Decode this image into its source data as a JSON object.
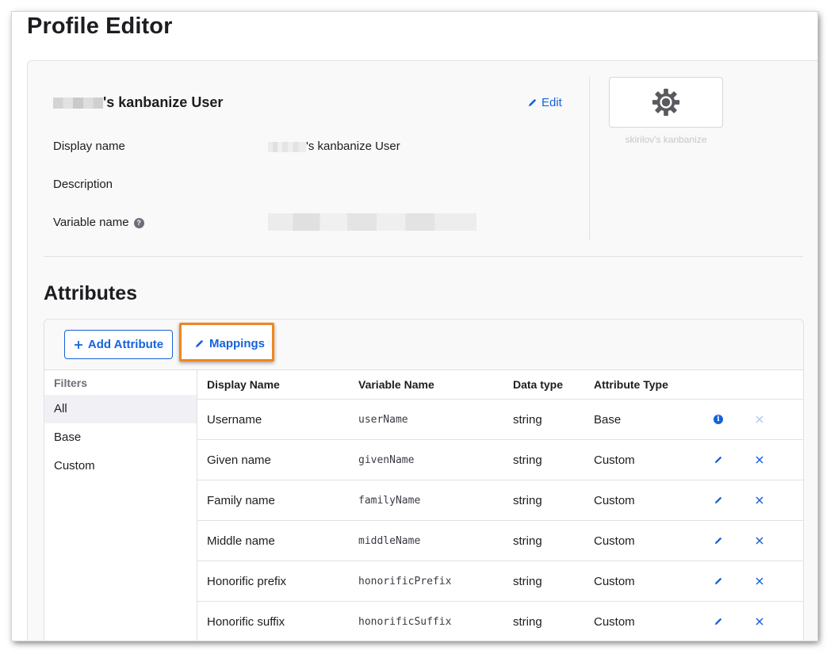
{
  "page": {
    "title": "Profile Editor"
  },
  "profile": {
    "header_suffix": "'s kanbanize User",
    "edit_label": "Edit",
    "fields": {
      "display_name_label": "Display name",
      "display_name_value_suffix": "'s kanbanize User",
      "description_label": "Description",
      "variable_name_label": "Variable name",
      "variable_name_help": "?"
    },
    "app_caption": "skirilov's kanbanize"
  },
  "attributes": {
    "title": "Attributes",
    "add_label": "Add Attribute",
    "mappings_label": "Mappings",
    "filters": {
      "title": "Filters",
      "items": [
        "All",
        "Base",
        "Custom"
      ],
      "active": "All"
    },
    "table": {
      "columns": [
        "Display Name",
        "Variable Name",
        "Data type",
        "Attribute Type"
      ],
      "rows": [
        {
          "display": "Username",
          "variable": "userName",
          "type": "string",
          "attr": "Base"
        },
        {
          "display": "Given name",
          "variable": "givenName",
          "type": "string",
          "attr": "Custom"
        },
        {
          "display": "Family name",
          "variable": "familyName",
          "type": "string",
          "attr": "Custom"
        },
        {
          "display": "Middle name",
          "variable": "middleName",
          "type": "string",
          "attr": "Custom"
        },
        {
          "display": "Honorific prefix",
          "variable": "honorificPrefix",
          "type": "string",
          "attr": "Custom"
        },
        {
          "display": "Honorific suffix",
          "variable": "honorificSuffix",
          "type": "string",
          "attr": "Custom"
        }
      ]
    }
  },
  "colors": {
    "accent": "#1662dd",
    "highlight": "#f0861e",
    "muted": "#c7c7cc"
  }
}
